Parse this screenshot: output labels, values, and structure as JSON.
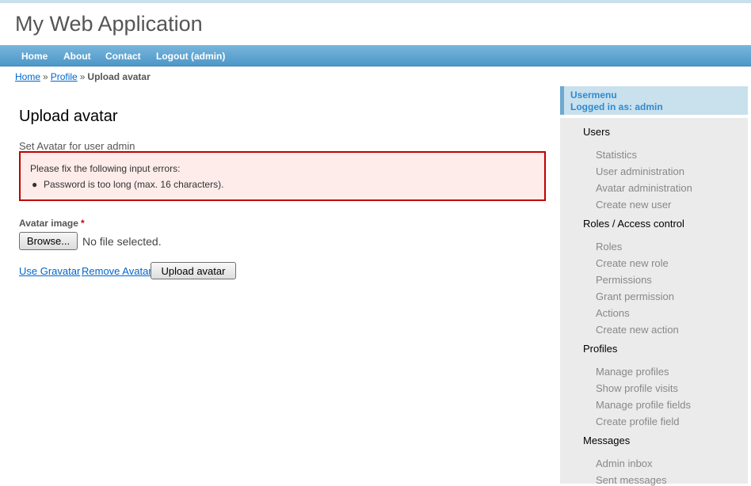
{
  "site": {
    "title": "My Web Application"
  },
  "nav": {
    "items": [
      {
        "label": "Home"
      },
      {
        "label": "About"
      },
      {
        "label": "Contact"
      },
      {
        "label": "Logout (admin)"
      }
    ]
  },
  "breadcrumb": {
    "items": [
      {
        "label": "Home"
      },
      {
        "label": "Profile"
      }
    ],
    "separator": "»",
    "current": "Upload avatar"
  },
  "main": {
    "heading": "Upload avatar",
    "note": "Set Avatar for user admin",
    "errors": {
      "header": "Please fix the following input errors:",
      "items": [
        "Password is too long (max. 16 characters)."
      ]
    },
    "avatar_field": {
      "label": "Avatar image",
      "required_marker": "*",
      "browse_label": "Browse...",
      "file_status": "No file selected."
    },
    "links": {
      "gravatar": "Use Gravatar",
      "remove": "Remove Avatar"
    },
    "submit_label": "Upload avatar"
  },
  "sidebar": {
    "title": "Usermenu",
    "logged_in": "Logged in as: admin",
    "sections": [
      {
        "title": "Users",
        "items": [
          "Statistics",
          "User administration",
          "Avatar administration",
          "Create new user"
        ]
      },
      {
        "title": "Roles / Access control",
        "items": [
          "Roles",
          "Create new role",
          "Permissions",
          "Grant permission",
          "Actions",
          "Create new action"
        ]
      },
      {
        "title": "Profiles",
        "items": [
          "Manage profiles",
          "Show profile visits",
          "Manage profile fields",
          "Create profile field"
        ]
      },
      {
        "title": "Messages",
        "items": [
          "Admin inbox",
          "Sent messages"
        ]
      }
    ]
  },
  "colors": {
    "nav_bar": "#4d97c8",
    "link": "#0066cc",
    "error_border": "#c00000",
    "error_bg": "#fdecea",
    "sidebar_bg": "#ebebeb",
    "usermenu_text": "#2f8ad1"
  }
}
